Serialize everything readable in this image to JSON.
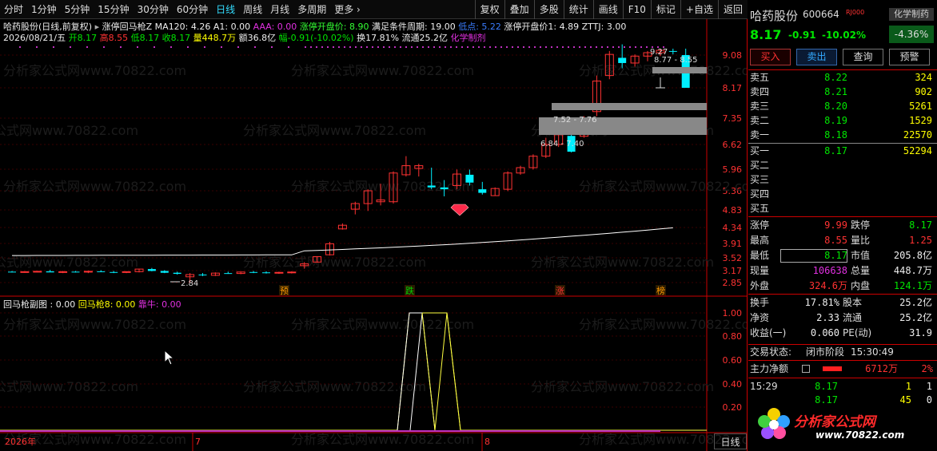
{
  "toolbar": {
    "periods": [
      "分时",
      "1分钟",
      "5分钟",
      "15分钟",
      "30分钟",
      "60分钟",
      "日线",
      "周线",
      "月线",
      "多周期",
      "更多"
    ],
    "active_period": "日线",
    "right_buttons": [
      "复权",
      "叠加",
      "多股",
      "统计",
      "画线",
      "F10",
      "标记",
      "+自选",
      "返回"
    ]
  },
  "chart": {
    "title_line": "哈药股份(日线,前复权)",
    "indicator_name": "涨停回马枪Z",
    "ma_label": "MA120: 4.26",
    "a1_label": "A1: 0.00",
    "aaa_label": "AAA: 0.00",
    "zt_open_label": "涨停开盘价: 8.90",
    "cond_period_label": "满足条件周期: 19.00",
    "low_point_label": "低点: 5.22",
    "zt_open1_label": "涨停开盘价1: 4.89",
    "zttj_label": "ZTTJ: 3.00",
    "date_line": "2026/08/21/五",
    "open_label": "开8.17",
    "high_label": "高8.55",
    "low_label": "低8.17",
    "close_label": "收8.17",
    "vol_label": "量448.7万",
    "amount_label": "额36.8亿",
    "change_label": "幅-0.91(-10.02%)",
    "turnover_label": "换17.81%",
    "float_label": "流通25.2亿",
    "industry_label": "化学制剂",
    "price_axis": [
      "9.08",
      "8.17",
      "7.35",
      "6.62",
      "5.96",
      "5.36",
      "4.83",
      "4.34",
      "3.91",
      "3.52",
      "3.17",
      "2.85"
    ],
    "zone_labels": [
      "8.77 - 8.55",
      "7.52 - 7.76",
      "6.84 - 7.40"
    ],
    "peak_label": "9.27",
    "low_marker_label": "2.84",
    "event_tags": [
      "预",
      "跌",
      "涨",
      "榜"
    ],
    "watermark": "分析家公式网www.70822.com"
  },
  "subchart": {
    "title": "回马枪副图 : 0.00",
    "series1_label": "回马枪8: 0.00",
    "series2_label": "靠牛: 0.00",
    "axis": [
      "1.00",
      "0.80",
      "0.60",
      "0.40",
      "0.20"
    ],
    "date_labels": [
      "2026年",
      "7",
      "8"
    ],
    "period_tag": "日线"
  },
  "panel": {
    "stock_name": "哈药股份",
    "stock_code": "600664",
    "rz_tag": "RJ000",
    "industry_tag": "化学制药",
    "price": "8.17",
    "change": "-0.91",
    "change_pct": "-10.02%",
    "industry_pct": "-4.36%",
    "buy_btn": "买入",
    "sell_btn": "卖出",
    "query_btn": "查询",
    "alert_btn": "预警",
    "asks": [
      {
        "label": "卖五",
        "price": "8.22",
        "vol": "324"
      },
      {
        "label": "卖四",
        "price": "8.21",
        "vol": "902"
      },
      {
        "label": "卖三",
        "price": "8.20",
        "vol": "5261"
      },
      {
        "label": "卖二",
        "price": "8.19",
        "vol": "1529"
      },
      {
        "label": "卖一",
        "price": "8.18",
        "vol": "22570"
      }
    ],
    "bids": [
      {
        "label": "买一",
        "price": "8.17",
        "vol": "52294"
      },
      {
        "label": "买二",
        "price": "",
        "vol": ""
      },
      {
        "label": "买三",
        "price": "",
        "vol": ""
      },
      {
        "label": "买四",
        "price": "",
        "vol": ""
      },
      {
        "label": "买五",
        "price": "",
        "vol": ""
      }
    ],
    "stats": {
      "limit_up_lbl": "涨停",
      "limit_up": "9.99",
      "limit_down_lbl": "跌停",
      "limit_down": "8.17",
      "high_lbl": "最高",
      "high": "8.55",
      "vol_ratio_lbl": "量比",
      "vol_ratio": "1.25",
      "low_lbl": "最低",
      "low": "8.17",
      "mkt_cap_lbl": "市值",
      "mkt_cap": "205.8亿",
      "cur_vol_lbl": "现量",
      "cur_vol": "106638",
      "total_vol_lbl": "总量",
      "total_vol": "448.7万",
      "outer_lbl": "外盘",
      "outer": "324.6万",
      "inner_lbl": "内盘",
      "inner": "124.1万",
      "turnover_lbl": "换手",
      "turnover": "17.81%",
      "equity_lbl": "股本",
      "equity": "25.2亿",
      "nav_lbl": "净资",
      "nav": "2.33",
      "float_lbl": "流通",
      "float": "25.2亿",
      "eps_lbl": "收益(一)",
      "eps": "0.060",
      "pe_lbl": "PE(动)",
      "pe": "31.9"
    },
    "trade_status_lbl": "交易状态:",
    "trade_status": "闭市阶段",
    "trade_time": "15:30:49",
    "main_flow_lbl": "主力净额",
    "main_flow": "6712万",
    "main_flow_pct": "2%",
    "ticks": [
      {
        "time": "15:29",
        "price": "8.17",
        "vol": "1",
        "dir": "1"
      },
      {
        "time": "",
        "price": "8.17",
        "vol": "45",
        "dir": "0"
      }
    ],
    "logo_text": "分析家公式网",
    "logo_url": "www.70822.com"
  },
  "colors": {
    "up": "#ff3232",
    "down": "#00e600",
    "bg": "#000000",
    "accent": "#3dd5f3"
  }
}
